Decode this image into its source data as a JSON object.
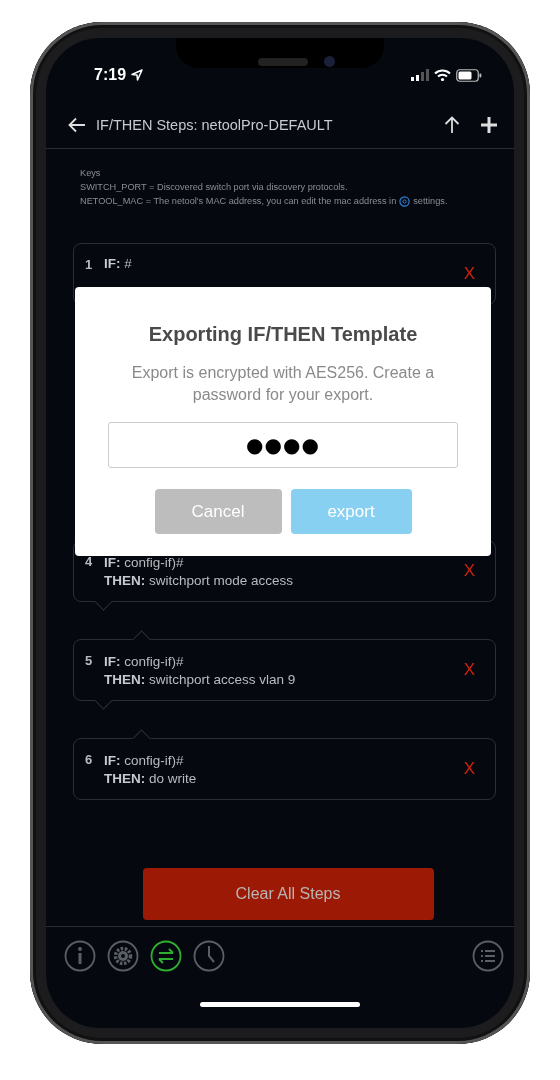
{
  "status_bar": {
    "time": "7:19"
  },
  "header": {
    "title": "IF/THEN Steps: netoolPro-DEFAULT"
  },
  "keys": {
    "heading": "Keys",
    "lines": [
      {
        "text": "SWITCH_PORT = Discovered switch port via discovery protocols."
      },
      {
        "text": "NETOOL_MAC = The netool's MAC address, you can edit the mac address in",
        "after_icon": "settings."
      }
    ]
  },
  "steps": [
    {
      "kind": "step",
      "number": "1",
      "if_label": "IF:",
      "if_value": "#",
      "delete": "X"
    },
    {
      "kind": "covered"
    },
    {
      "kind": "covered"
    },
    {
      "kind": "step",
      "number": "4",
      "if_label": "IF:",
      "if_value": "config-if)#",
      "then_label": "THEN:",
      "then_value": "switchport mode access",
      "delete": "X"
    },
    {
      "kind": "step",
      "number": "5",
      "if_label": "IF:",
      "if_value": "config-if)#",
      "then_label": "THEN:",
      "then_value": "switchport access vlan 9",
      "delete": "X"
    },
    {
      "kind": "step",
      "number": "6",
      "if_label": "IF:",
      "if_value": "config-if)#",
      "then_label": "THEN:",
      "then_value": "do write",
      "delete": "X"
    }
  ],
  "clear_button": "Clear All Steps",
  "tab_bar": [
    {
      "kind": "info",
      "selected": false
    },
    {
      "kind": "settings",
      "selected": false
    },
    {
      "kind": "swap",
      "selected": true
    },
    {
      "kind": "clock",
      "selected": false
    },
    {
      "kind": "list",
      "selected": false
    }
  ],
  "dialog": {
    "title": "Exporting IF/THEN Template",
    "message": "Export is encrypted with AES256. Create a password for your export.",
    "password_mask": "●●●●",
    "buttons": [
      {
        "kind": "cancel",
        "label": "Cancel"
      },
      {
        "kind": "primary",
        "label": "export"
      }
    ]
  }
}
